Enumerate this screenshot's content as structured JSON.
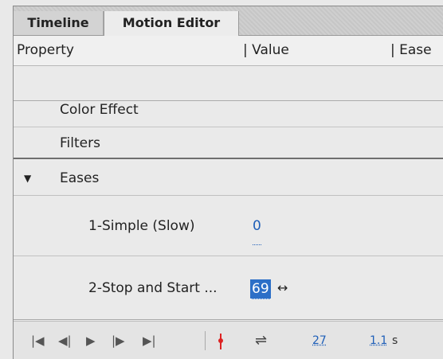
{
  "tabs": [
    {
      "label": "Timeline",
      "active": false
    },
    {
      "label": "Motion Editor",
      "active": true
    }
  ],
  "header": {
    "property": "Property",
    "value": "| Value",
    "ease": "| Ease"
  },
  "rows": {
    "color_effect": "Color Effect",
    "filters": "Filters",
    "eases": {
      "arrow": "▼",
      "label": "Eases"
    },
    "ease1": {
      "label": "1-Simple (Slow)",
      "value": "0"
    },
    "ease2": {
      "label": "2-Stop and Start ...",
      "value": "69"
    }
  },
  "cursor": "↔",
  "toolbar": {
    "first": "|◀",
    "prev": "◀|",
    "play": "▶",
    "next": "|▶",
    "last": "▶|",
    "loop": "⇌",
    "frame": "27",
    "time": "1.1",
    "time_unit": "s"
  },
  "colors": {
    "link": "#1f5fb8",
    "selection": "#2c6fc7",
    "playhead": "#dd2222"
  }
}
